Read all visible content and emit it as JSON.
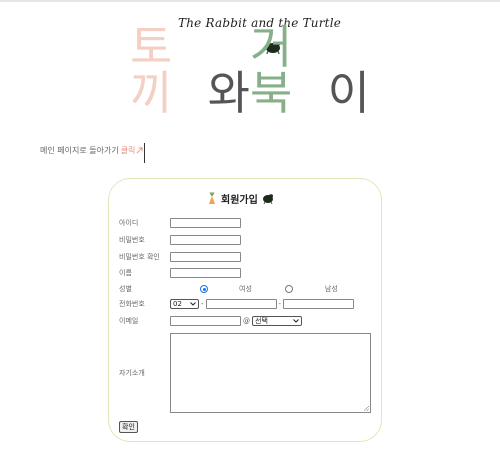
{
  "header": {
    "subtitle": "The Rabbit and the Turtle",
    "title_rabbit": "토끼",
    "title_wa": "와",
    "title_turtle": "거북",
    "title_i": "이",
    "nav_link": "메인 페이지로 돌아가기",
    "nav_click": "클릭"
  },
  "form": {
    "title": "회원가입",
    "labels": {
      "id": "아이디",
      "password": "비밀번호",
      "password_confirm": "비밀번호 확인",
      "name": "이름",
      "gender": "성별",
      "phone": "전화번호",
      "email": "이메일",
      "intro": "자기소개"
    },
    "gender_options": {
      "female": "여성",
      "male": "남성"
    },
    "phone_prefix": "02",
    "phone_dash": "-",
    "email_at": "@",
    "email_domain_select": "선택",
    "submit_label": "확인"
  },
  "colors": {
    "rabbit_pink": "#f3cfc4",
    "turtle_green": "#86b08a",
    "card_border": "#dfe8b8",
    "radio_blue": "#1a73e8"
  }
}
